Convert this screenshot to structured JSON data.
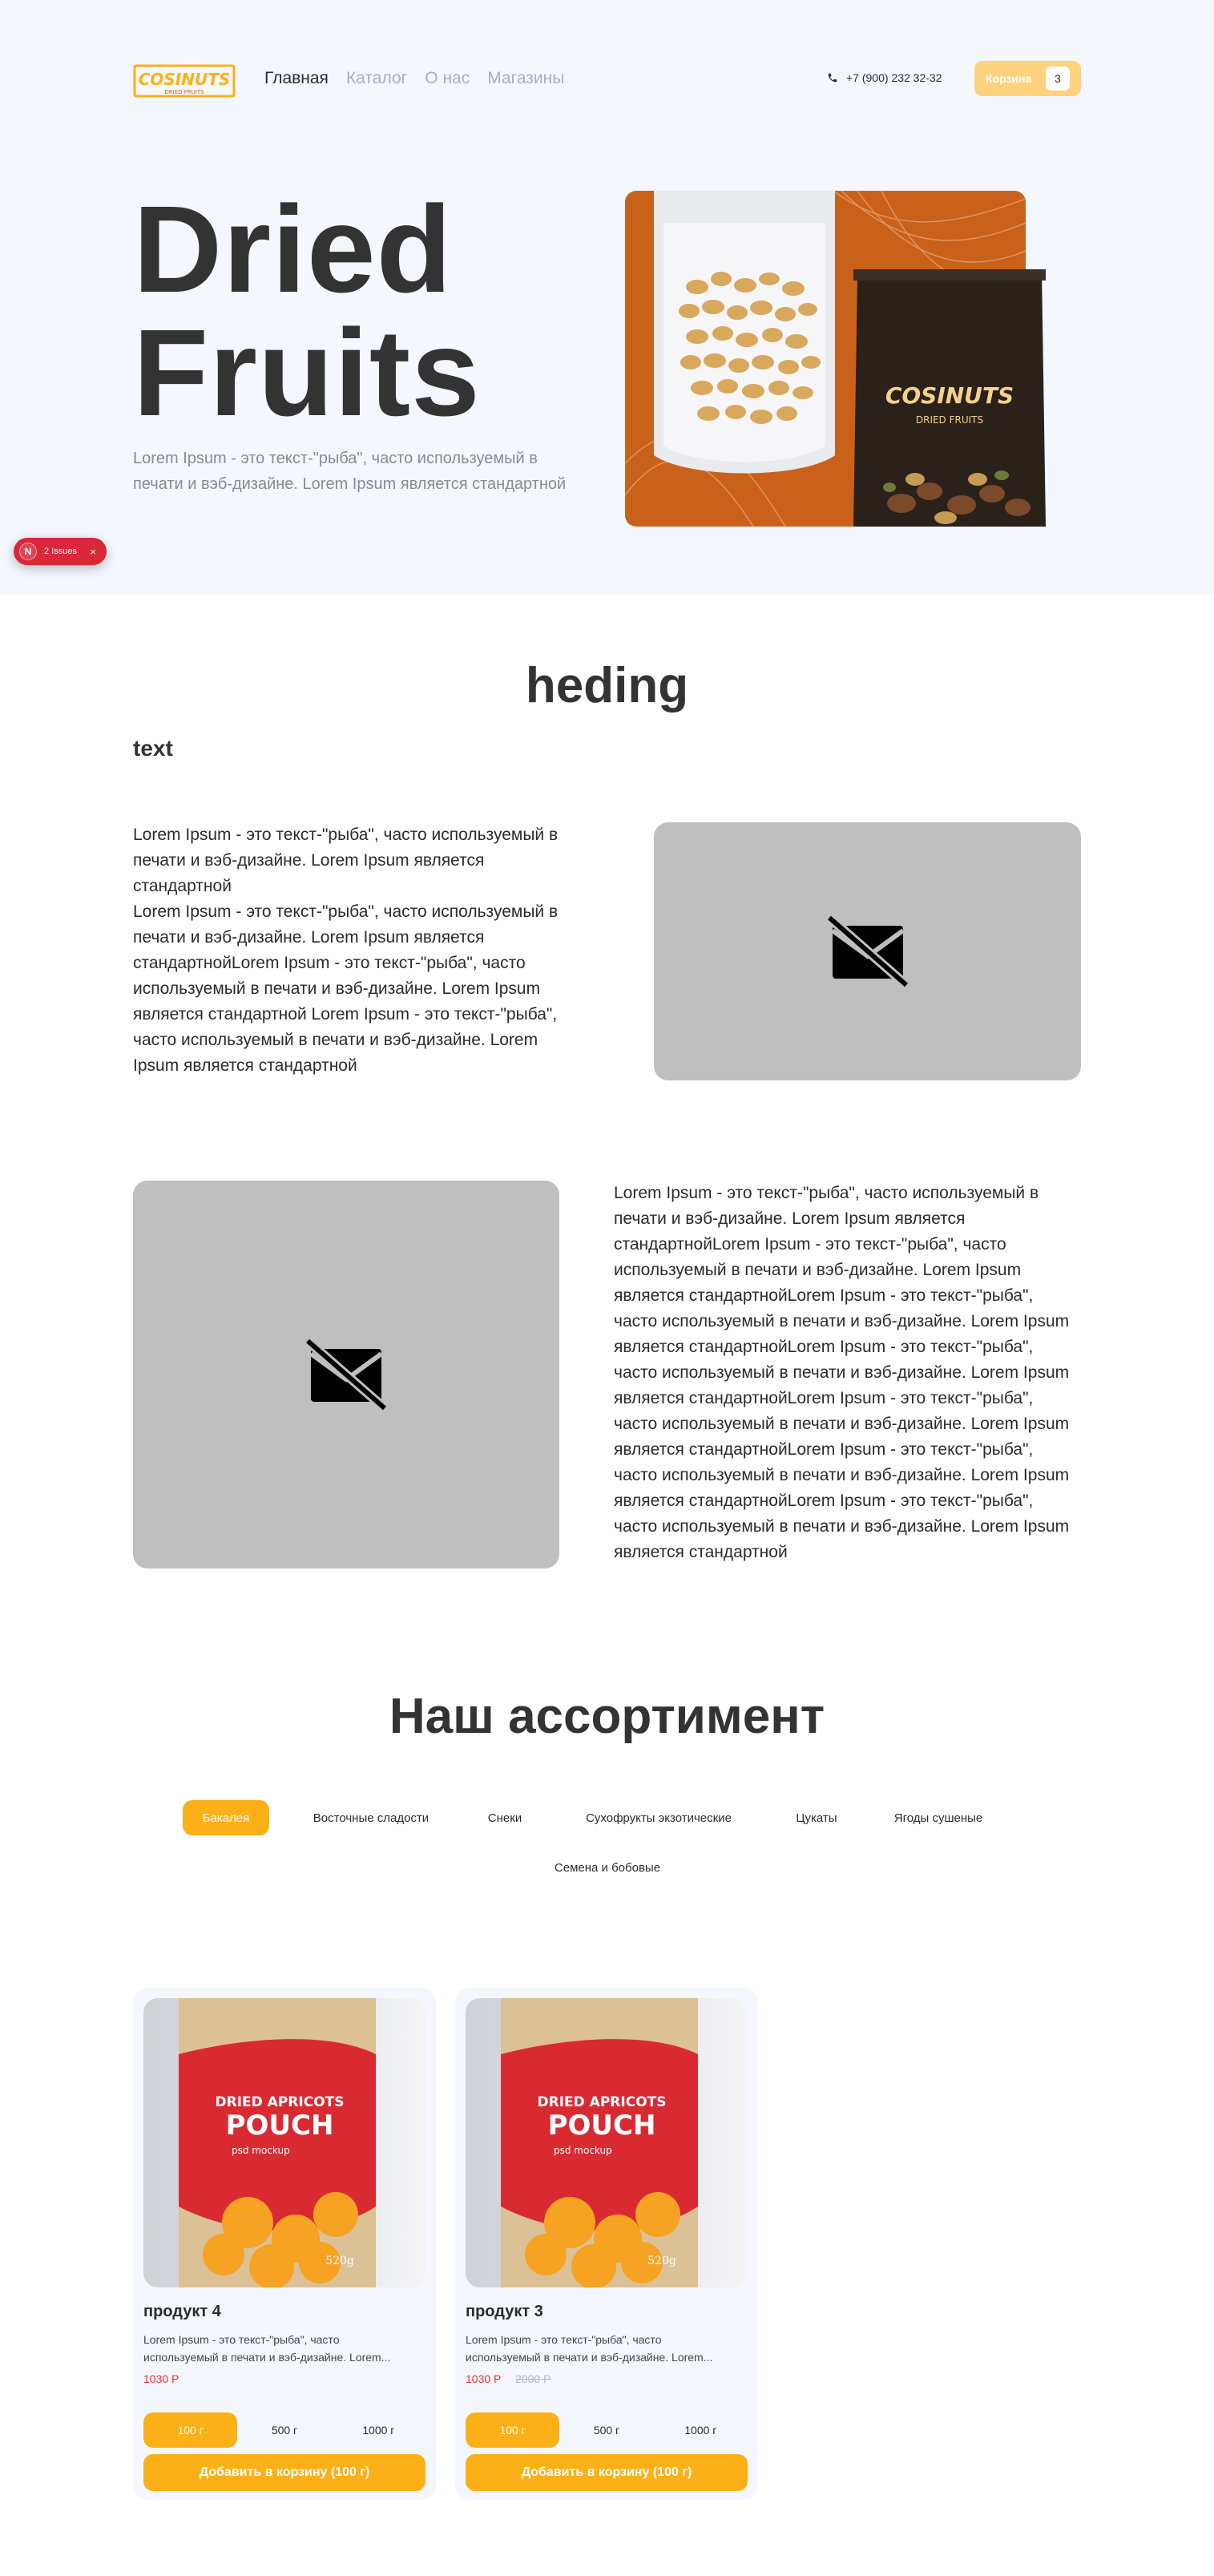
{
  "header": {
    "logo_text": "COSINUTS",
    "logo_sub": "DRIED FRUITS",
    "nav": [
      {
        "label": "Главная"
      },
      {
        "label": "Каталог"
      },
      {
        "label": "О нас"
      },
      {
        "label": "Магазины"
      }
    ],
    "phone": "+7 (900) 232 32-32",
    "cart_label": "Корзина",
    "cart_count": "3"
  },
  "hero": {
    "title_line1": "Dried",
    "title_line2": "Fruits",
    "description": "Lorem Ipsum - это текст-\"рыба\", часто используемый в печати и вэб-дизайне. Lorem Ipsum является стандартной",
    "pack_brand": "COSINUTS",
    "pack_sub": "DRIED FRUITS"
  },
  "issues_badge": {
    "letter": "N",
    "label": "2 Issues",
    "close": "×"
  },
  "section": {
    "heading": "heding",
    "subtext": "text",
    "para1_a": "Lorem Ipsum - это текст-\"рыба\", часто используемый в печати и вэб-дизайне. Lorem Ipsum является стандартной",
    "para1_b": "Lorem Ipsum - это текст-\"рыба\", часто используемый в печати и вэб-дизайне. Lorem Ipsum является стандартнойLorem Ipsum - это текст-\"рыба\", часто используемый в печати и вэб-дизайне. Lorem Ipsum является стандартной Lorem Ipsum - это текст-\"рыба\", часто используемый в печати и вэб-дизайне. Lorem Ipsum является стандартной",
    "para2": "Lorem Ipsum - это текст-\"рыба\", часто используемый в печати и вэб-дизайне. Lorem Ipsum является стандартнойLorem Ipsum - это текст-\"рыба\", часто используемый в печати и вэб-дизайне. Lorem Ipsum является стандартнойLorem Ipsum - это текст-\"рыба\", часто используемый в печати и вэб-дизайне. Lorem Ipsum является стандартнойLorem Ipsum - это текст-\"рыба\", часто используемый в печати и вэб-дизайне. Lorem Ipsum является стандартнойLorem Ipsum - это текст-\"рыба\", часто используемый в печати и вэб-дизайне. Lorem Ipsum является стандартнойLorem Ipsum - это текст-\"рыба\", часто используемый в печати и вэб-дизайне. Lorem Ipsum является стандартнойLorem Ipsum - это текст-\"рыба\", часто используемый в печати и вэб-дизайне. Lorem Ipsum является стандартной"
  },
  "assortment": {
    "heading": "Наш ассортимент",
    "categories": [
      {
        "label": "Бакалея"
      },
      {
        "label": "Восточные сладости"
      },
      {
        "label": "Снеки"
      },
      {
        "label": "Сухофрукты экзотические"
      },
      {
        "label": "Цукаты"
      },
      {
        "label": "Ягоды сушеные"
      },
      {
        "label": "Семена и бобовые"
      }
    ]
  },
  "products": [
    {
      "name": "продукт 4",
      "desc": "Lorem Ipsum - это текст-\"рыба\", часто используемый в печати и вэб-дизайне. Lorem...",
      "price": "1030 Р",
      "old_price": "",
      "weights": [
        "100 г",
        "500 г",
        "1000 г"
      ],
      "add_label": "Добавить в корзину (100 г)",
      "pack_title1": "DRIED APRICOTS",
      "pack_title2": "POUCH",
      "pack_sub": "psd mockup",
      "pack_weight": "520g"
    },
    {
      "name": "продукт 3",
      "desc": "Lorem Ipsum - это текст-\"рыба\", часто используемый в печати и вэб-дизайне. Lorem...",
      "price": "1030 Р",
      "old_price": "2000 Р",
      "weights": [
        "100 г",
        "500 г",
        "1000 г"
      ],
      "add_label": "Добавить в корзину (100 г)",
      "pack_title1": "DRIED APRICOTS",
      "pack_title2": "POUCH",
      "pack_sub": "psd mockup",
      "pack_weight": "520g"
    }
  ],
  "colors": {
    "accent": "#fcb017",
    "cart": "#ffd27e",
    "hero_bg": "#f4f7fe",
    "price": "#e5322d",
    "placeholder": "#bfbfbf",
    "brand_orange": "#c9611b"
  }
}
